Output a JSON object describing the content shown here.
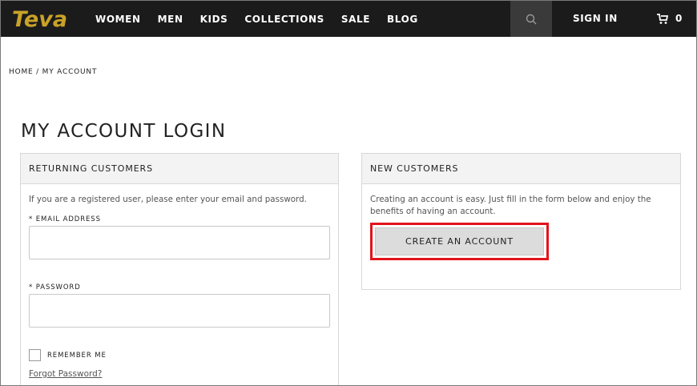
{
  "brand": {
    "logo_text": "Teva",
    "logo_color": "#c9a227"
  },
  "nav": {
    "items": [
      "WOMEN",
      "MEN",
      "KIDS",
      "COLLECTIONS",
      "SALE",
      "BLOG"
    ]
  },
  "header": {
    "search_icon": "search-icon",
    "signin_label": "SIGN IN",
    "cart_icon": "cart-icon",
    "cart_count": "0"
  },
  "breadcrumb": "HOME / MY ACCOUNT",
  "page_title": "MY ACCOUNT LOGIN",
  "returning": {
    "heading": "RETURNING CUSTOMERS",
    "description": "If you are a registered user, please enter your email and password.",
    "email_label": "* EMAIL ADDRESS",
    "email_value": "",
    "password_label": "* PASSWORD",
    "password_value": "",
    "remember_label": "REMEMBER ME",
    "remember_checked": false,
    "forgot_label": "Forgot Password?"
  },
  "new_customers": {
    "heading": "NEW CUSTOMERS",
    "description": "Creating an account is easy. Just fill in the form below and enjoy the benefits of having an account.",
    "create_button": "CREATE AN ACCOUNT",
    "highlight_color": "#e3131b"
  }
}
